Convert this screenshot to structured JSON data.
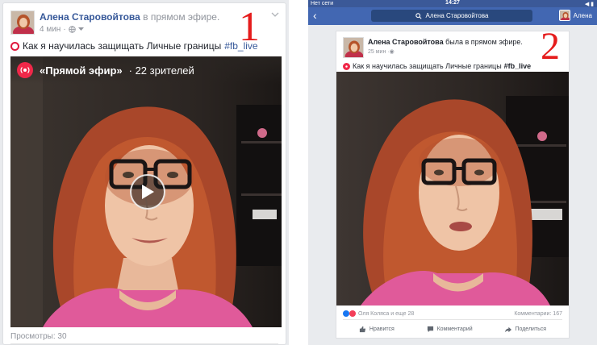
{
  "panel1": {
    "author": "Алена Старовойтова",
    "action": "в прямом эфире.",
    "time": "4 мин",
    "post_title": "Как я научилась защищать Личные границы",
    "hashtag": "#fb_live",
    "live_label": "«Прямой эфир»",
    "viewers": "· 22 зрителей",
    "views": "Просмотры: 30",
    "number": "1",
    "icons": [
      "globe-icon",
      "chevron-down-icon",
      "play-icon",
      "live-icon"
    ]
  },
  "panel2": {
    "status": {
      "carrier": "Нет сети",
      "time": "14:27",
      "battery": "◀ ▮"
    },
    "nav": {
      "search_text": "Алена Старовойтова",
      "user": "Алена",
      "back": "‹"
    },
    "author": "Алена Старовойтова",
    "action": "была в прямом эфире.",
    "time": "25 мин",
    "post_title": "Как я научилась защищать Личные границы",
    "hashtag": "#fb_live",
    "reactions": "Оля Коляса и еще 28",
    "comments": "Комментарии: 167",
    "actions": {
      "like": "Нравится",
      "comment": "Комментарий",
      "share": "Поделиться"
    },
    "number": "2"
  },
  "colors": {
    "facebook_blue": "#4267b2",
    "link_blue": "#365899",
    "live_red": "#f02849",
    "annotation_red": "#e51c1c"
  }
}
